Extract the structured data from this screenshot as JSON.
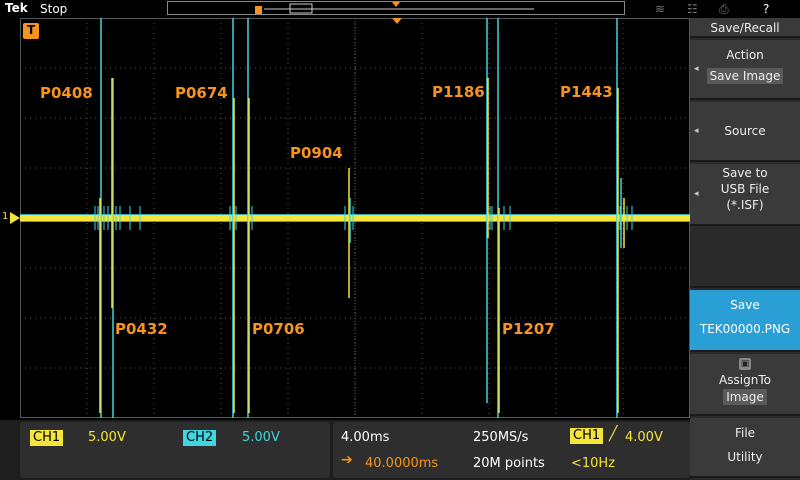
{
  "topbar": {
    "brand": "Tek",
    "status": "Stop"
  },
  "waveform": {
    "trigger_marker": "T",
    "ground_marker": "1",
    "labels_upper": [
      "P0408",
      "P0674",
      "P0904",
      "P1186",
      "P1443"
    ],
    "labels_lower": [
      "P0432",
      "P0706",
      "P1207"
    ]
  },
  "channels": {
    "ch1": {
      "label": "CH1",
      "scale": "5.00V",
      "color": "#f5e43a"
    },
    "ch2": {
      "label": "CH2",
      "scale": "5.00V",
      "color": "#3fd6e0"
    }
  },
  "horizontal": {
    "timebase": "4.00ms",
    "sample_rate": "250MS/s",
    "position": "40.0000ms",
    "record_length": "20M points"
  },
  "trigger": {
    "source": "CH1",
    "level": "4.00V",
    "freq": "<10Hz"
  },
  "side_menu": {
    "title": "Save/Recall",
    "action_label": "Action",
    "action_value": "Save Image",
    "source_label": "Source",
    "save_to_line1": "Save to",
    "save_to_line2": "USB File",
    "save_to_line3": "(*.ISF)",
    "save_label": "Save",
    "save_file": "TEK00000.PNG",
    "assign_label": "AssignTo",
    "assign_value": "Image",
    "file_label": "File",
    "utility_label": "Utility"
  },
  "colors": {
    "accent": "#f7941d",
    "menu_highlight": "#2a9fd6"
  }
}
